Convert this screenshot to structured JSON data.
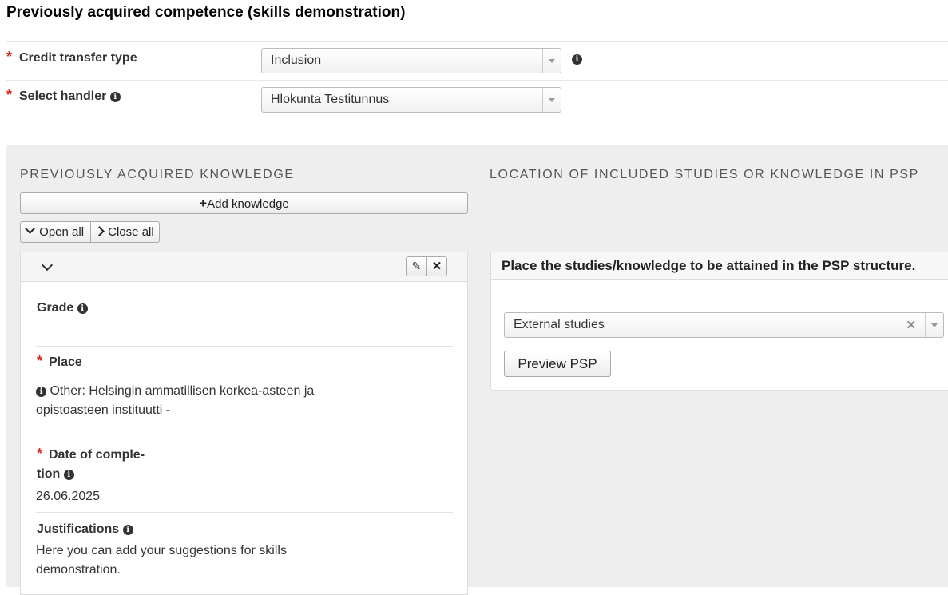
{
  "page": {
    "title": "Previously acquired competence (skills demonstration)"
  },
  "form": {
    "credit_transfer_type": {
      "label": "Credit transfer type",
      "value": "Inclusion"
    },
    "handler": {
      "label": "Select handler",
      "value": "Hlokunta Testitunnus"
    }
  },
  "knowledge": {
    "heading": "PREVIOUSLY ACQUIRED KNOWLEDGE",
    "add_button": "Add knowledge",
    "open_all": "Open all",
    "close_all": "Close all",
    "item": {
      "grade_label": "Grade",
      "place_label": "Place",
      "place_value_line1": "Other: Helsingin ammatillisen korkea-asteen ja",
      "place_value_line2": "opistoasteen instituutti -",
      "date_label_line1": "Date of comple-",
      "date_label_line2": "tion",
      "date_value": "26.06.2025",
      "justifications_label": "Justifications",
      "justifications_line1": "Here you can add your suggestions for skills",
      "justifications_line2": "demonstration."
    }
  },
  "location": {
    "heading": "LOCATION OF INCLUDED STUDIES OR KNOWLEDGE IN PSP",
    "panel_title": "Place the studies/knowledge to be attained in the PSP structure.",
    "select_value": "External studies",
    "preview_button": "Preview PSP"
  }
}
